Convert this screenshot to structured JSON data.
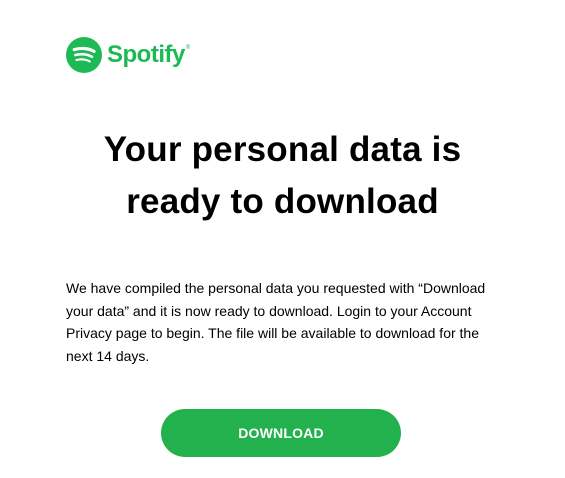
{
  "brand": {
    "name": "Spotify",
    "trademark": "®",
    "icon": "spotify-logo-icon",
    "color": "#1DB954"
  },
  "email": {
    "headline_lines": [
      "Your personal data is",
      "ready to download"
    ],
    "body_lines": [
      "We have compiled the personal data you requested with “Download",
      "your data” and it is now ready to download. Login to your Account",
      "Privacy page to begin. The file will be available to download for the",
      "next 14 days."
    ],
    "download_label": "DOWNLOAD"
  },
  "colors": {
    "button_background": "#23B14D",
    "button_text": "#FFFFFF",
    "text": "#000000",
    "background": "#FFFFFF"
  }
}
